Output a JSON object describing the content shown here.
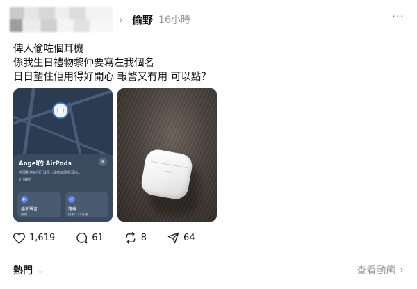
{
  "header": {
    "author": "偷野",
    "time": "16小時",
    "more_icon": "more-dots-icon"
  },
  "post": {
    "lines": [
      "俾人偷咗個耳機",
      "係我生日禮物黎仲要寫左我個名",
      "日日望住佢用得好開心 報警又冇用 可以點？"
    ]
  },
  "map_card": {
    "title": "Angel的 AirPods",
    "address": "中國香港特別行政區九龍觀塘區新蒲崗…",
    "distance": "2分鐘前",
    "actions": [
      {
        "label": "播放聲音",
        "sub": "關閉"
      },
      {
        "label": "路線",
        "sub": "開車：14分鐘"
      }
    ]
  },
  "stats": {
    "likes": "1,619",
    "comments": "61",
    "reposts": "8",
    "shares": "64"
  },
  "footer": {
    "left": "熱門",
    "right": "查看動態"
  }
}
